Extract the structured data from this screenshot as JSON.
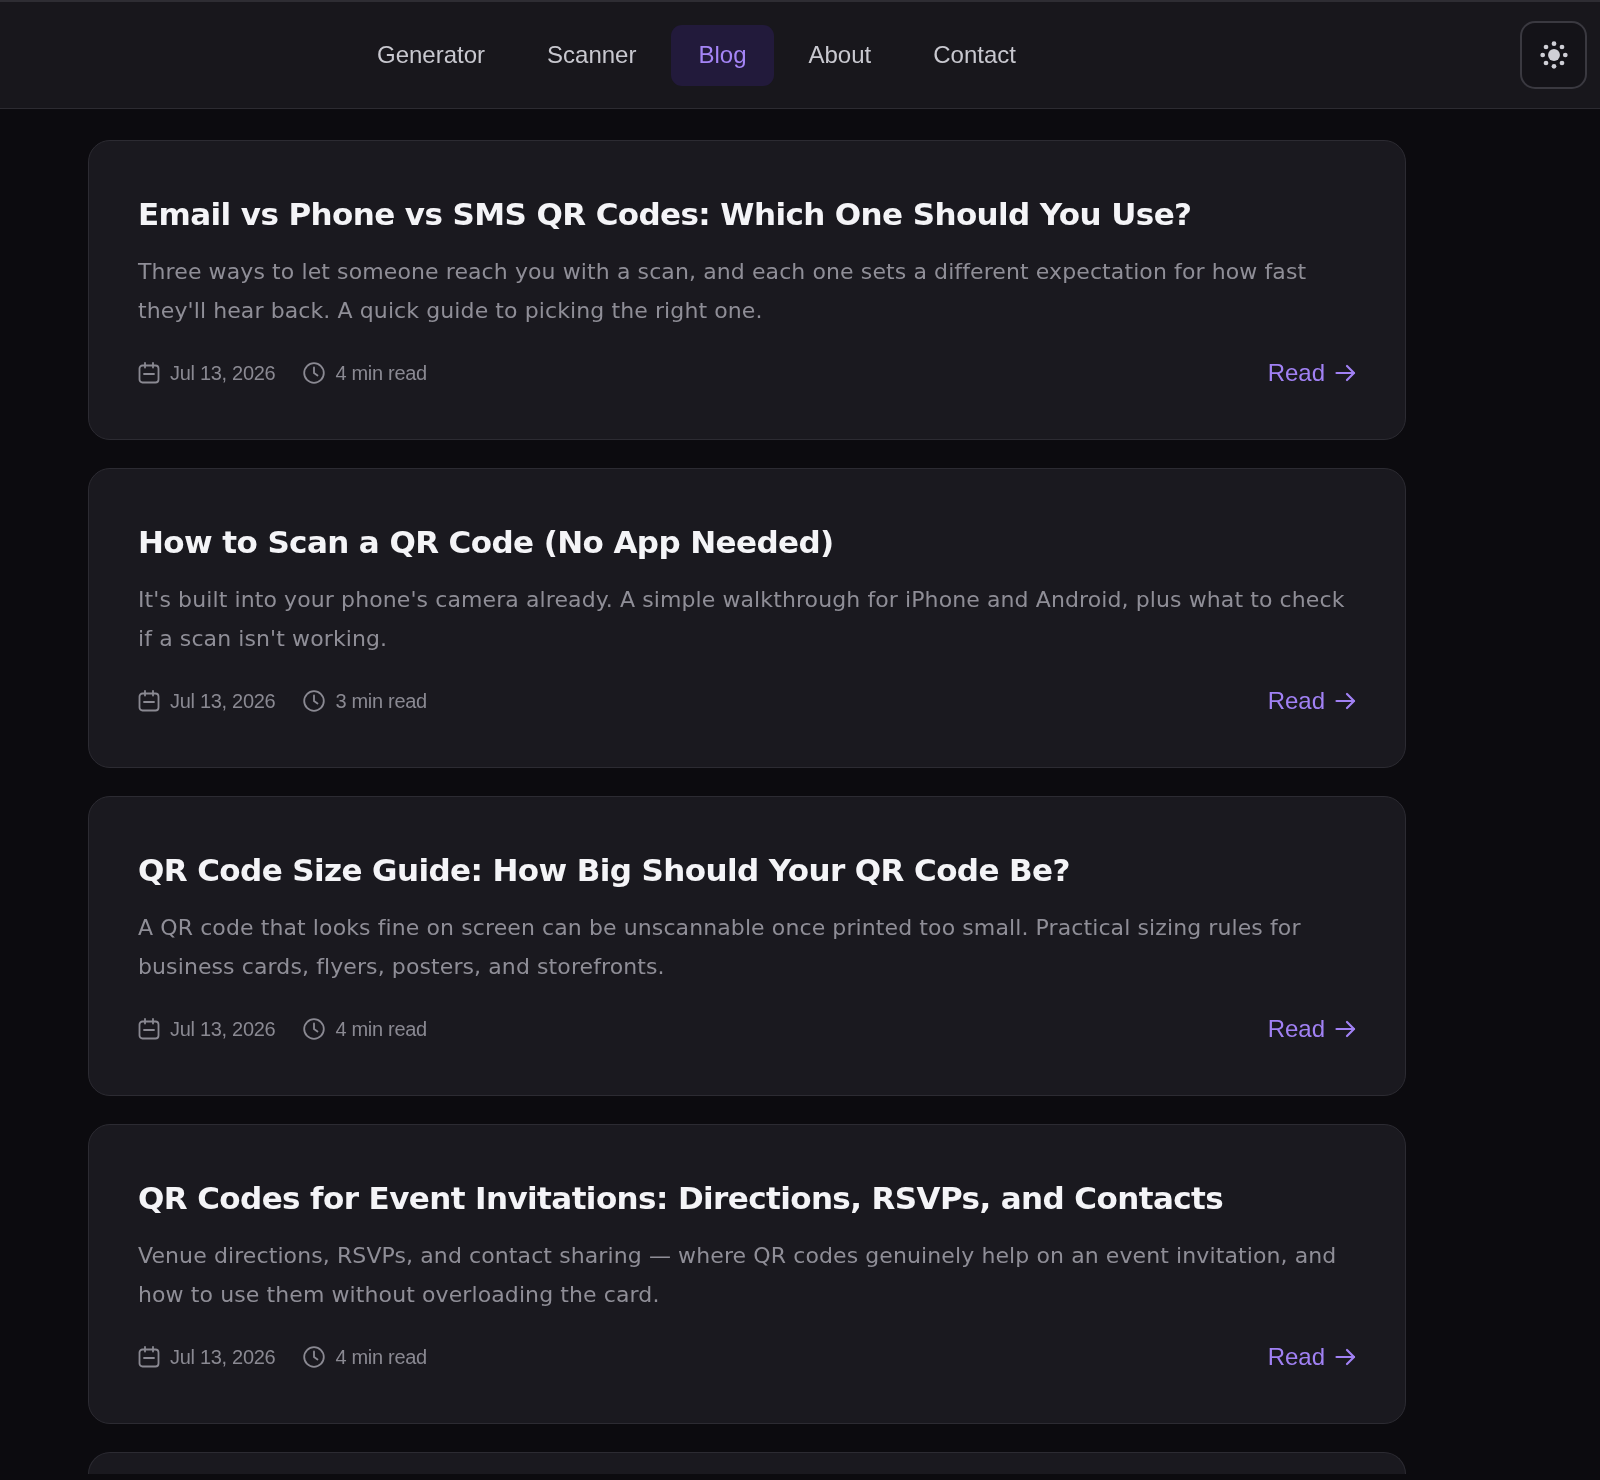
{
  "nav": {
    "items": [
      {
        "label": "Generator",
        "selected": false
      },
      {
        "label": "Scanner",
        "selected": false
      },
      {
        "label": "Blog",
        "selected": true
      },
      {
        "label": "About",
        "selected": false
      },
      {
        "label": "Contact",
        "selected": false
      }
    ]
  },
  "posts": [
    {
      "title": "Email vs Phone vs SMS QR Codes: Which One Should You Use?",
      "excerpt": "Three ways to let someone reach you with a scan, and each one sets a different expectation for how fast they'll hear back. A quick guide to picking the right one.",
      "date": "Jul 13, 2026",
      "read_time": "4 min read",
      "link": "Read"
    },
    {
      "title": "How to Scan a QR Code (No App Needed)",
      "excerpt": "It's built into your phone's camera already. A simple walkthrough for iPhone and Android, plus what to check if a scan isn't working.",
      "date": "Jul 13, 2026",
      "read_time": "3 min read",
      "link": "Read"
    },
    {
      "title": "QR Code Size Guide: How Big Should Your QR Code Be?",
      "excerpt": "A QR code that looks fine on screen can be unscannable once printed too small. Practical sizing rules for business cards, flyers, posters, and storefronts.",
      "date": "Jul 13, 2026",
      "read_time": "4 min read",
      "link": "Read"
    },
    {
      "title": "QR Codes for Event Invitations: Directions, RSVPs, and Contacts",
      "excerpt": "Venue directions, RSVPs, and contact sharing — where QR codes genuinely help on an event invitation, and how to use them without overloading the card.",
      "date": "Jul 13, 2026",
      "read_time": "4 min read",
      "link": "Read"
    }
  ]
}
